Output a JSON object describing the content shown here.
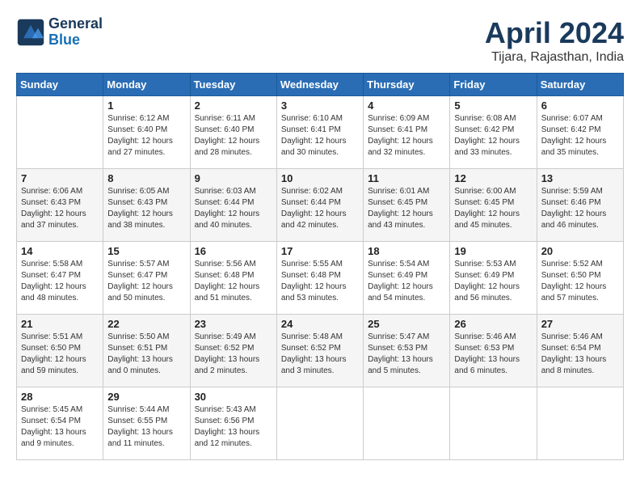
{
  "header": {
    "logo_line1": "General",
    "logo_line2": "Blue",
    "month": "April 2024",
    "location": "Tijara, Rajasthan, India"
  },
  "weekdays": [
    "Sunday",
    "Monday",
    "Tuesday",
    "Wednesday",
    "Thursday",
    "Friday",
    "Saturday"
  ],
  "weeks": [
    [
      {
        "day": "",
        "detail": ""
      },
      {
        "day": "1",
        "detail": "Sunrise: 6:12 AM\nSunset: 6:40 PM\nDaylight: 12 hours\nand 27 minutes."
      },
      {
        "day": "2",
        "detail": "Sunrise: 6:11 AM\nSunset: 6:40 PM\nDaylight: 12 hours\nand 28 minutes."
      },
      {
        "day": "3",
        "detail": "Sunrise: 6:10 AM\nSunset: 6:41 PM\nDaylight: 12 hours\nand 30 minutes."
      },
      {
        "day": "4",
        "detail": "Sunrise: 6:09 AM\nSunset: 6:41 PM\nDaylight: 12 hours\nand 32 minutes."
      },
      {
        "day": "5",
        "detail": "Sunrise: 6:08 AM\nSunset: 6:42 PM\nDaylight: 12 hours\nand 33 minutes."
      },
      {
        "day": "6",
        "detail": "Sunrise: 6:07 AM\nSunset: 6:42 PM\nDaylight: 12 hours\nand 35 minutes."
      }
    ],
    [
      {
        "day": "7",
        "detail": "Sunrise: 6:06 AM\nSunset: 6:43 PM\nDaylight: 12 hours\nand 37 minutes."
      },
      {
        "day": "8",
        "detail": "Sunrise: 6:05 AM\nSunset: 6:43 PM\nDaylight: 12 hours\nand 38 minutes."
      },
      {
        "day": "9",
        "detail": "Sunrise: 6:03 AM\nSunset: 6:44 PM\nDaylight: 12 hours\nand 40 minutes."
      },
      {
        "day": "10",
        "detail": "Sunrise: 6:02 AM\nSunset: 6:44 PM\nDaylight: 12 hours\nand 42 minutes."
      },
      {
        "day": "11",
        "detail": "Sunrise: 6:01 AM\nSunset: 6:45 PM\nDaylight: 12 hours\nand 43 minutes."
      },
      {
        "day": "12",
        "detail": "Sunrise: 6:00 AM\nSunset: 6:45 PM\nDaylight: 12 hours\nand 45 minutes."
      },
      {
        "day": "13",
        "detail": "Sunrise: 5:59 AM\nSunset: 6:46 PM\nDaylight: 12 hours\nand 46 minutes."
      }
    ],
    [
      {
        "day": "14",
        "detail": "Sunrise: 5:58 AM\nSunset: 6:47 PM\nDaylight: 12 hours\nand 48 minutes."
      },
      {
        "day": "15",
        "detail": "Sunrise: 5:57 AM\nSunset: 6:47 PM\nDaylight: 12 hours\nand 50 minutes."
      },
      {
        "day": "16",
        "detail": "Sunrise: 5:56 AM\nSunset: 6:48 PM\nDaylight: 12 hours\nand 51 minutes."
      },
      {
        "day": "17",
        "detail": "Sunrise: 5:55 AM\nSunset: 6:48 PM\nDaylight: 12 hours\nand 53 minutes."
      },
      {
        "day": "18",
        "detail": "Sunrise: 5:54 AM\nSunset: 6:49 PM\nDaylight: 12 hours\nand 54 minutes."
      },
      {
        "day": "19",
        "detail": "Sunrise: 5:53 AM\nSunset: 6:49 PM\nDaylight: 12 hours\nand 56 minutes."
      },
      {
        "day": "20",
        "detail": "Sunrise: 5:52 AM\nSunset: 6:50 PM\nDaylight: 12 hours\nand 57 minutes."
      }
    ],
    [
      {
        "day": "21",
        "detail": "Sunrise: 5:51 AM\nSunset: 6:50 PM\nDaylight: 12 hours\nand 59 minutes."
      },
      {
        "day": "22",
        "detail": "Sunrise: 5:50 AM\nSunset: 6:51 PM\nDaylight: 13 hours\nand 0 minutes."
      },
      {
        "day": "23",
        "detail": "Sunrise: 5:49 AM\nSunset: 6:52 PM\nDaylight: 13 hours\nand 2 minutes."
      },
      {
        "day": "24",
        "detail": "Sunrise: 5:48 AM\nSunset: 6:52 PM\nDaylight: 13 hours\nand 3 minutes."
      },
      {
        "day": "25",
        "detail": "Sunrise: 5:47 AM\nSunset: 6:53 PM\nDaylight: 13 hours\nand 5 minutes."
      },
      {
        "day": "26",
        "detail": "Sunrise: 5:46 AM\nSunset: 6:53 PM\nDaylight: 13 hours\nand 6 minutes."
      },
      {
        "day": "27",
        "detail": "Sunrise: 5:46 AM\nSunset: 6:54 PM\nDaylight: 13 hours\nand 8 minutes."
      }
    ],
    [
      {
        "day": "28",
        "detail": "Sunrise: 5:45 AM\nSunset: 6:54 PM\nDaylight: 13 hours\nand 9 minutes."
      },
      {
        "day": "29",
        "detail": "Sunrise: 5:44 AM\nSunset: 6:55 PM\nDaylight: 13 hours\nand 11 minutes."
      },
      {
        "day": "30",
        "detail": "Sunrise: 5:43 AM\nSunset: 6:56 PM\nDaylight: 13 hours\nand 12 minutes."
      },
      {
        "day": "",
        "detail": ""
      },
      {
        "day": "",
        "detail": ""
      },
      {
        "day": "",
        "detail": ""
      },
      {
        "day": "",
        "detail": ""
      }
    ]
  ]
}
